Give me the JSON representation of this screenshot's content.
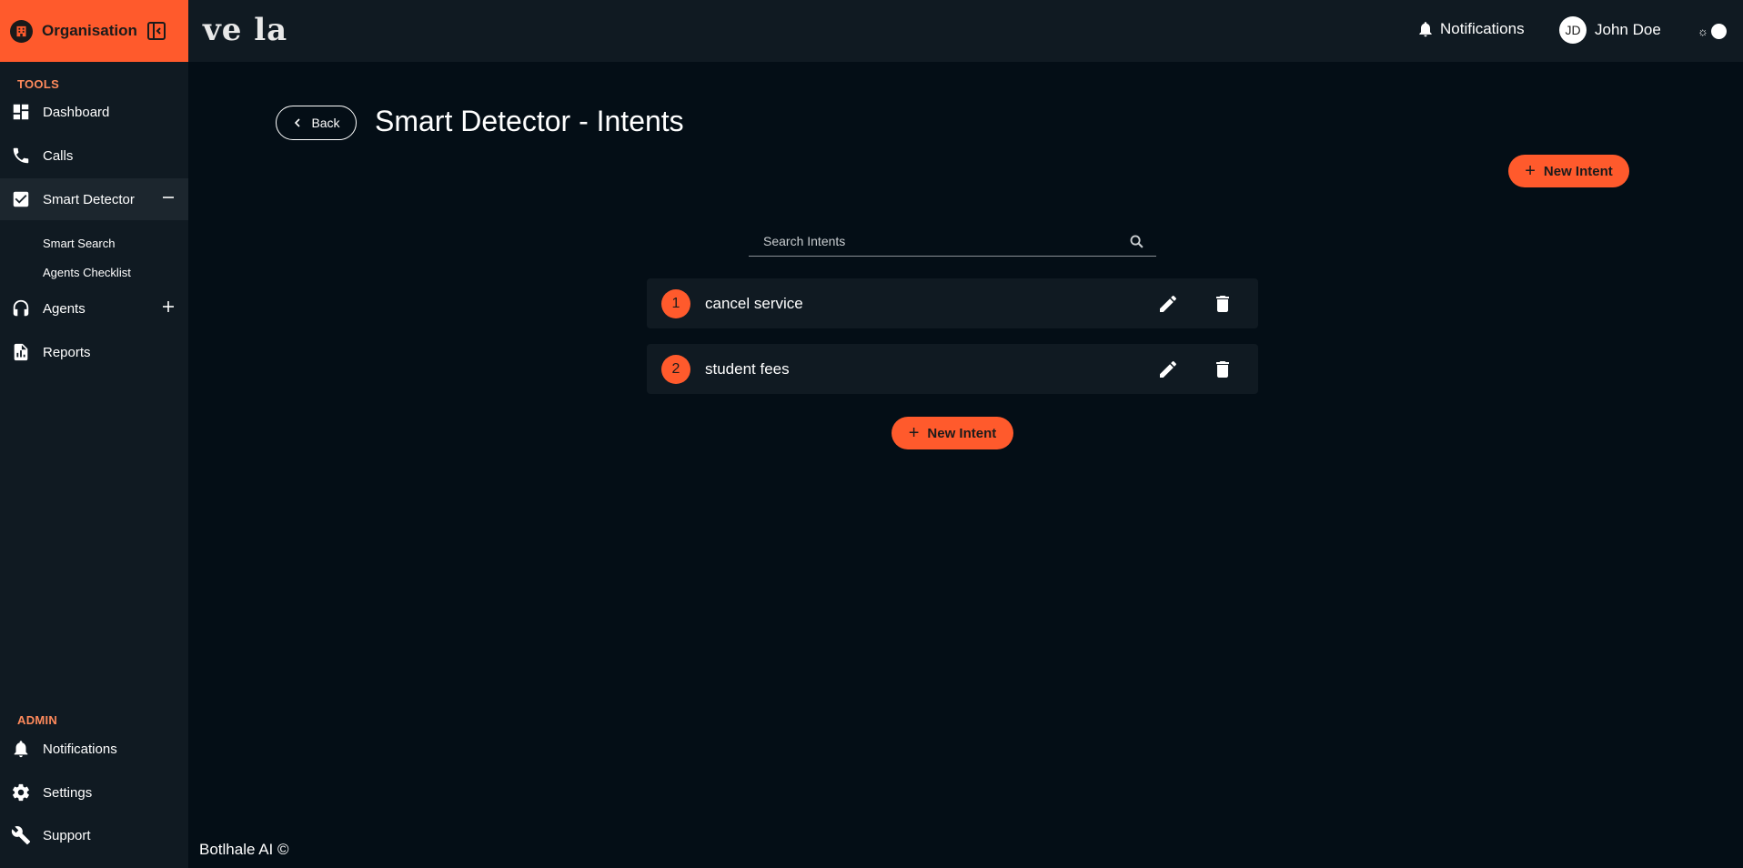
{
  "sidebar": {
    "org_name": "Organisation",
    "tools_title": "TOOLS",
    "admin_title": "ADMIN",
    "items": {
      "dashboard": "Dashboard",
      "calls": "Calls",
      "smart_detector": "Smart Detector",
      "smart_search": "Smart Search",
      "agents_checklist": "Agents Checklist",
      "agents": "Agents",
      "reports": "Reports",
      "notifications": "Notifications",
      "settings": "Settings",
      "support": "Support"
    }
  },
  "header": {
    "logo_text": "ve la",
    "notifications_label": "Notifications",
    "user_initials": "JD",
    "user_name": "John Doe"
  },
  "main": {
    "back_label": "Back",
    "title": "Smart Detector - Intents",
    "new_intent_label": "New Intent",
    "search_placeholder": "Search Intents",
    "intents": [
      {
        "number": "1",
        "name": "cancel service"
      },
      {
        "number": "2",
        "name": "student fees"
      }
    ]
  },
  "footer": {
    "text": "Botlhale AI ©"
  },
  "colors": {
    "accent": "#ff5a2c",
    "background": "#040e16",
    "panel": "#101a22",
    "active_item": "#1c262e",
    "section_title": "#ff8a5c"
  }
}
